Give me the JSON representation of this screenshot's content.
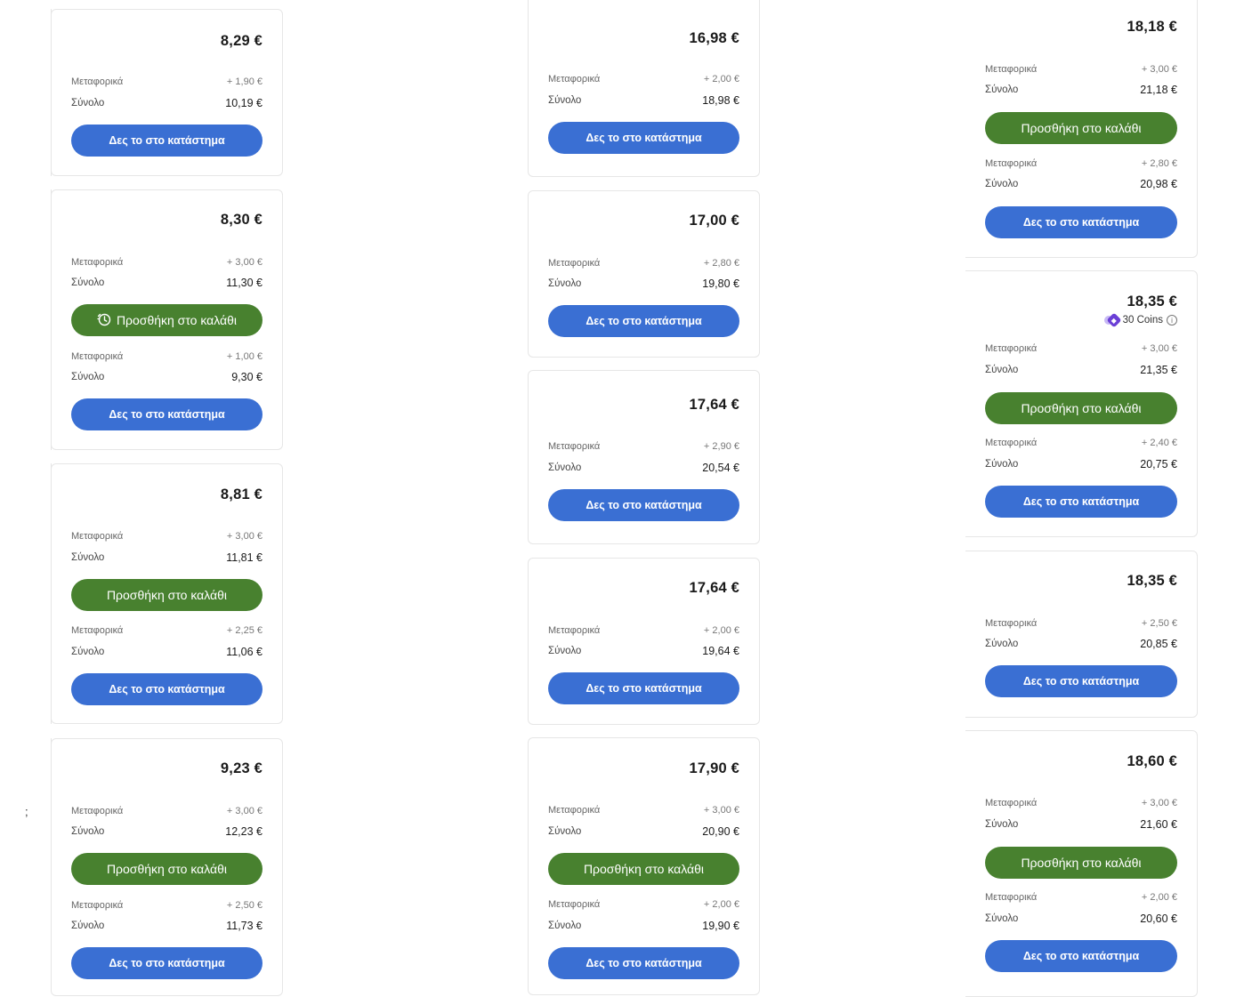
{
  "labels": {
    "shipping": "Μεταφορικά",
    "total": "Σύνολο",
    "view_in_store": "Δες το στο κατάστημα",
    "add_to_cart": "Προσθήκη στο καλάθι"
  },
  "colors": {
    "blue_button": "#3a6fd3",
    "green_button": "#48812f",
    "coins_badge": "#6a3fd6"
  },
  "icons": {
    "timer": "timer-icon",
    "coins": "coins-icon",
    "info": "info-icon"
  },
  "stray_char": ";",
  "columns": [
    {
      "offers": [
        {
          "price": "8,29 €",
          "ship1": "+ 1,90 €",
          "total1": "10,19 €"
        },
        {
          "price": "8,30 €",
          "ship1": "+ 3,00 €",
          "total1": "11,30 €",
          "ship2": "+ 1,00 €",
          "total2": "9,30 €"
        },
        {
          "price": "8,81 €",
          "ship1": "+ 3,00 €",
          "total1": "11,81 €",
          "ship2": "+ 2,25 €",
          "total2": "11,06 €"
        },
        {
          "price": "9,23 €",
          "ship1": "+ 3,00 €",
          "total1": "12,23 €",
          "ship2": "+ 2,50 €",
          "total2": "11,73 €"
        }
      ]
    },
    {
      "offers": [
        {
          "price": "16,98 €",
          "ship1": "+ 2,00 €",
          "total1": "18,98 €"
        },
        {
          "price": "17,00 €",
          "ship1": "+ 2,80 €",
          "total1": "19,80 €"
        },
        {
          "price": "17,64 €",
          "ship1": "+ 2,90 €",
          "total1": "20,54 €"
        },
        {
          "price": "17,64 €",
          "ship1": "+ 2,00 €",
          "total1": "19,64 €"
        },
        {
          "price": "17,90 €",
          "ship1": "+ 3,00 €",
          "total1": "20,90 €",
          "ship2": "+ 2,00 €",
          "total2": "19,90 €"
        }
      ]
    },
    {
      "offers": [
        {
          "price": "18,18 €",
          "ship1": "+ 3,00 €",
          "total1": "21,18 €",
          "ship2": "+ 2,80 €",
          "total2": "20,98 €"
        },
        {
          "price": "18,35 €",
          "coins": "30 Coins",
          "ship1": "+ 3,00 €",
          "total1": "21,35 €",
          "ship2": "+ 2,40 €",
          "total2": "20,75 €"
        },
        {
          "price": "18,35 €",
          "ship1": "+ 2,50 €",
          "total1": "20,85 €"
        },
        {
          "price": "18,60 €",
          "ship1": "+ 3,00 €",
          "total1": "21,60 €",
          "ship2": "+ 2,00 €",
          "total2": "20,60 €"
        }
      ]
    }
  ]
}
